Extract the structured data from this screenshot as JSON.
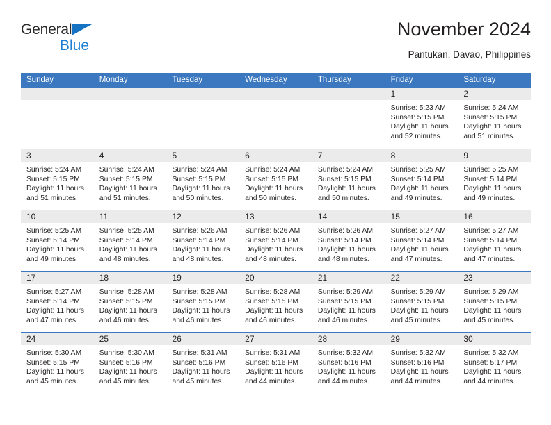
{
  "brand": {
    "line1": "General",
    "line2": "Blue",
    "triangle_color": "#1673c4",
    "text_color": "#2b2b2b",
    "blue_text_color": "#1f7fd0"
  },
  "header": {
    "title": "November 2024",
    "subtitle": "Pantukan, Davao, Philippines"
  },
  "colors": {
    "header_blue": "#3c78bf",
    "daynum_band": "#ebebeb",
    "text": "#231f20"
  },
  "weekdays": [
    "Sunday",
    "Monday",
    "Tuesday",
    "Wednesday",
    "Thursday",
    "Friday",
    "Saturday"
  ],
  "weeks": [
    [
      {
        "day": "",
        "empty": true,
        "sunrise": "",
        "sunset": "",
        "daylight1": "",
        "daylight2": ""
      },
      {
        "day": "",
        "empty": true,
        "sunrise": "",
        "sunset": "",
        "daylight1": "",
        "daylight2": ""
      },
      {
        "day": "",
        "empty": true,
        "sunrise": "",
        "sunset": "",
        "daylight1": "",
        "daylight2": ""
      },
      {
        "day": "",
        "empty": true,
        "sunrise": "",
        "sunset": "",
        "daylight1": "",
        "daylight2": ""
      },
      {
        "day": "",
        "empty": true,
        "sunrise": "",
        "sunset": "",
        "daylight1": "",
        "daylight2": ""
      },
      {
        "day": "1",
        "empty": false,
        "sunrise": "Sunrise: 5:23 AM",
        "sunset": "Sunset: 5:15 PM",
        "daylight1": "Daylight: 11 hours",
        "daylight2": "and 52 minutes."
      },
      {
        "day": "2",
        "empty": false,
        "sunrise": "Sunrise: 5:24 AM",
        "sunset": "Sunset: 5:15 PM",
        "daylight1": "Daylight: 11 hours",
        "daylight2": "and 51 minutes."
      }
    ],
    [
      {
        "day": "3",
        "empty": false,
        "sunrise": "Sunrise: 5:24 AM",
        "sunset": "Sunset: 5:15 PM",
        "daylight1": "Daylight: 11 hours",
        "daylight2": "and 51 minutes."
      },
      {
        "day": "4",
        "empty": false,
        "sunrise": "Sunrise: 5:24 AM",
        "sunset": "Sunset: 5:15 PM",
        "daylight1": "Daylight: 11 hours",
        "daylight2": "and 51 minutes."
      },
      {
        "day": "5",
        "empty": false,
        "sunrise": "Sunrise: 5:24 AM",
        "sunset": "Sunset: 5:15 PM",
        "daylight1": "Daylight: 11 hours",
        "daylight2": "and 50 minutes."
      },
      {
        "day": "6",
        "empty": false,
        "sunrise": "Sunrise: 5:24 AM",
        "sunset": "Sunset: 5:15 PM",
        "daylight1": "Daylight: 11 hours",
        "daylight2": "and 50 minutes."
      },
      {
        "day": "7",
        "empty": false,
        "sunrise": "Sunrise: 5:24 AM",
        "sunset": "Sunset: 5:15 PM",
        "daylight1": "Daylight: 11 hours",
        "daylight2": "and 50 minutes."
      },
      {
        "day": "8",
        "empty": false,
        "sunrise": "Sunrise: 5:25 AM",
        "sunset": "Sunset: 5:14 PM",
        "daylight1": "Daylight: 11 hours",
        "daylight2": "and 49 minutes."
      },
      {
        "day": "9",
        "empty": false,
        "sunrise": "Sunrise: 5:25 AM",
        "sunset": "Sunset: 5:14 PM",
        "daylight1": "Daylight: 11 hours",
        "daylight2": "and 49 minutes."
      }
    ],
    [
      {
        "day": "10",
        "empty": false,
        "sunrise": "Sunrise: 5:25 AM",
        "sunset": "Sunset: 5:14 PM",
        "daylight1": "Daylight: 11 hours",
        "daylight2": "and 49 minutes."
      },
      {
        "day": "11",
        "empty": false,
        "sunrise": "Sunrise: 5:25 AM",
        "sunset": "Sunset: 5:14 PM",
        "daylight1": "Daylight: 11 hours",
        "daylight2": "and 48 minutes."
      },
      {
        "day": "12",
        "empty": false,
        "sunrise": "Sunrise: 5:26 AM",
        "sunset": "Sunset: 5:14 PM",
        "daylight1": "Daylight: 11 hours",
        "daylight2": "and 48 minutes."
      },
      {
        "day": "13",
        "empty": false,
        "sunrise": "Sunrise: 5:26 AM",
        "sunset": "Sunset: 5:14 PM",
        "daylight1": "Daylight: 11 hours",
        "daylight2": "and 48 minutes."
      },
      {
        "day": "14",
        "empty": false,
        "sunrise": "Sunrise: 5:26 AM",
        "sunset": "Sunset: 5:14 PM",
        "daylight1": "Daylight: 11 hours",
        "daylight2": "and 48 minutes."
      },
      {
        "day": "15",
        "empty": false,
        "sunrise": "Sunrise: 5:27 AM",
        "sunset": "Sunset: 5:14 PM",
        "daylight1": "Daylight: 11 hours",
        "daylight2": "and 47 minutes."
      },
      {
        "day": "16",
        "empty": false,
        "sunrise": "Sunrise: 5:27 AM",
        "sunset": "Sunset: 5:14 PM",
        "daylight1": "Daylight: 11 hours",
        "daylight2": "and 47 minutes."
      }
    ],
    [
      {
        "day": "17",
        "empty": false,
        "sunrise": "Sunrise: 5:27 AM",
        "sunset": "Sunset: 5:14 PM",
        "daylight1": "Daylight: 11 hours",
        "daylight2": "and 47 minutes."
      },
      {
        "day": "18",
        "empty": false,
        "sunrise": "Sunrise: 5:28 AM",
        "sunset": "Sunset: 5:15 PM",
        "daylight1": "Daylight: 11 hours",
        "daylight2": "and 46 minutes."
      },
      {
        "day": "19",
        "empty": false,
        "sunrise": "Sunrise: 5:28 AM",
        "sunset": "Sunset: 5:15 PM",
        "daylight1": "Daylight: 11 hours",
        "daylight2": "and 46 minutes."
      },
      {
        "day": "20",
        "empty": false,
        "sunrise": "Sunrise: 5:28 AM",
        "sunset": "Sunset: 5:15 PM",
        "daylight1": "Daylight: 11 hours",
        "daylight2": "and 46 minutes."
      },
      {
        "day": "21",
        "empty": false,
        "sunrise": "Sunrise: 5:29 AM",
        "sunset": "Sunset: 5:15 PM",
        "daylight1": "Daylight: 11 hours",
        "daylight2": "and 46 minutes."
      },
      {
        "day": "22",
        "empty": false,
        "sunrise": "Sunrise: 5:29 AM",
        "sunset": "Sunset: 5:15 PM",
        "daylight1": "Daylight: 11 hours",
        "daylight2": "and 45 minutes."
      },
      {
        "day": "23",
        "empty": false,
        "sunrise": "Sunrise: 5:29 AM",
        "sunset": "Sunset: 5:15 PM",
        "daylight1": "Daylight: 11 hours",
        "daylight2": "and 45 minutes."
      }
    ],
    [
      {
        "day": "24",
        "empty": false,
        "sunrise": "Sunrise: 5:30 AM",
        "sunset": "Sunset: 5:15 PM",
        "daylight1": "Daylight: 11 hours",
        "daylight2": "and 45 minutes."
      },
      {
        "day": "25",
        "empty": false,
        "sunrise": "Sunrise: 5:30 AM",
        "sunset": "Sunset: 5:16 PM",
        "daylight1": "Daylight: 11 hours",
        "daylight2": "and 45 minutes."
      },
      {
        "day": "26",
        "empty": false,
        "sunrise": "Sunrise: 5:31 AM",
        "sunset": "Sunset: 5:16 PM",
        "daylight1": "Daylight: 11 hours",
        "daylight2": "and 45 minutes."
      },
      {
        "day": "27",
        "empty": false,
        "sunrise": "Sunrise: 5:31 AM",
        "sunset": "Sunset: 5:16 PM",
        "daylight1": "Daylight: 11 hours",
        "daylight2": "and 44 minutes."
      },
      {
        "day": "28",
        "empty": false,
        "sunrise": "Sunrise: 5:32 AM",
        "sunset": "Sunset: 5:16 PM",
        "daylight1": "Daylight: 11 hours",
        "daylight2": "and 44 minutes."
      },
      {
        "day": "29",
        "empty": false,
        "sunrise": "Sunrise: 5:32 AM",
        "sunset": "Sunset: 5:16 PM",
        "daylight1": "Daylight: 11 hours",
        "daylight2": "and 44 minutes."
      },
      {
        "day": "30",
        "empty": false,
        "sunrise": "Sunrise: 5:32 AM",
        "sunset": "Sunset: 5:17 PM",
        "daylight1": "Daylight: 11 hours",
        "daylight2": "and 44 minutes."
      }
    ]
  ]
}
